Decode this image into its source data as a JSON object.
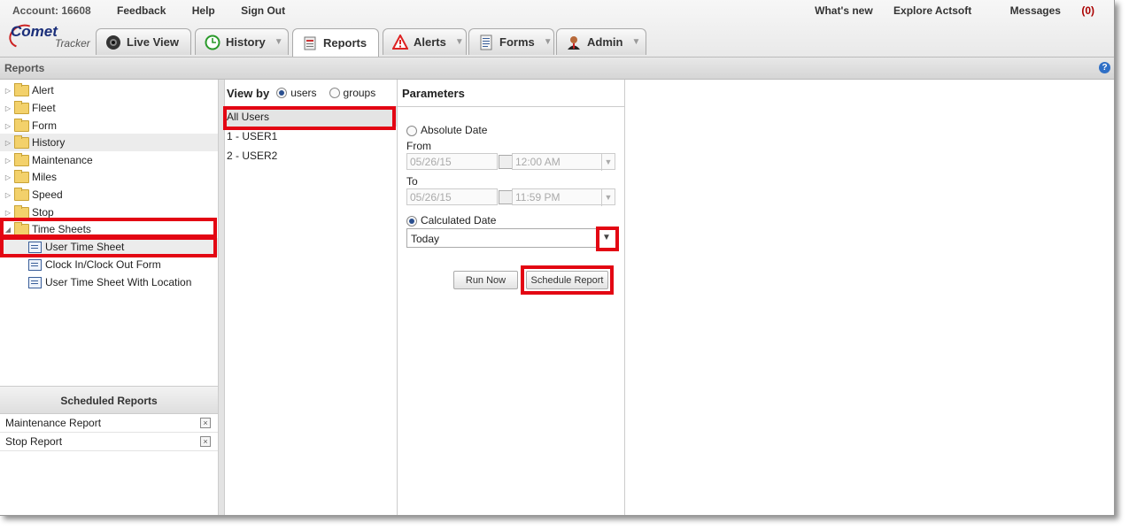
{
  "topbar": {
    "account": "Account: 16608",
    "feedback": "Feedback",
    "help": "Help",
    "sign_out": "Sign Out",
    "whats_new": "What's new",
    "explore": "Explore Actsoft",
    "messages": "Messages",
    "messages_count": "(0)"
  },
  "logo": {
    "brand": "Comet",
    "sub": "Tracker"
  },
  "tabs": [
    {
      "label": "Live View",
      "icon": "camera-icon"
    },
    {
      "label": "History",
      "icon": "clock-icon"
    },
    {
      "label": "Reports",
      "icon": "report-icon"
    },
    {
      "label": "Alerts",
      "icon": "warning-icon"
    },
    {
      "label": "Forms",
      "icon": "form-icon"
    },
    {
      "label": "Admin",
      "icon": "admin-user-icon"
    }
  ],
  "section_title": "Reports",
  "help_icon": "?",
  "tree": {
    "folders": [
      "Alert",
      "Fleet",
      "Form",
      "History",
      "Maintenance",
      "Miles",
      "Speed",
      "Stop",
      "Time Sheets"
    ],
    "reports": [
      "User Time Sheet",
      "Clock In/Clock Out Form",
      "User Time Sheet With Location"
    ]
  },
  "scheduled": {
    "title": "Scheduled Reports",
    "items": [
      "Maintenance Report",
      "Stop Report"
    ]
  },
  "users": {
    "view_by": "View by",
    "opt_users": "users",
    "opt_groups": "groups",
    "rows": [
      "All Users",
      "1 - USER1",
      "2 - USER2"
    ]
  },
  "params": {
    "title": "Parameters",
    "absolute_date": "Absolute Date",
    "from": "From",
    "from_date": "05/26/15",
    "from_time": "12:00 AM",
    "to": "To",
    "to_date": "05/26/15",
    "to_time": "11:59 PM",
    "calculated_date": "Calculated Date",
    "calculated_value": "Today",
    "run_now": "Run Now",
    "schedule_report": "Schedule Report"
  },
  "colors": {
    "highlight": "#e30613",
    "accent": "#1b2f7a"
  }
}
